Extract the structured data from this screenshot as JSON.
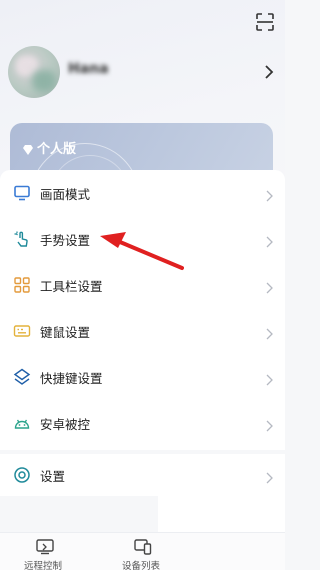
{
  "header": {
    "username": "Hana"
  },
  "vip": {
    "label": "个人版"
  },
  "menu": {
    "items": [
      {
        "label": "画面模式",
        "icon": "monitor-icon"
      },
      {
        "label": "手势设置",
        "icon": "gesture-hand-icon"
      },
      {
        "label": "工具栏设置",
        "icon": "toolbar-grid-icon"
      },
      {
        "label": "键鼠设置",
        "icon": "keyboard-icon"
      },
      {
        "label": "快捷键设置",
        "icon": "layers-shortcut-icon"
      },
      {
        "label": "安卓被控",
        "icon": "android-icon"
      }
    ]
  },
  "settings": {
    "label": "设置",
    "icon": "settings-ring-icon"
  },
  "bottom_nav": {
    "remote_control": "远程控制",
    "device_list": "设备列表"
  },
  "colors": {
    "accent_blue": "#3a7bd5",
    "icon_orange": "#e39a3c",
    "icon_teal": "#1f8a9a",
    "annotation_red": "#e02020",
    "vip_card": "#b6c3dc"
  }
}
